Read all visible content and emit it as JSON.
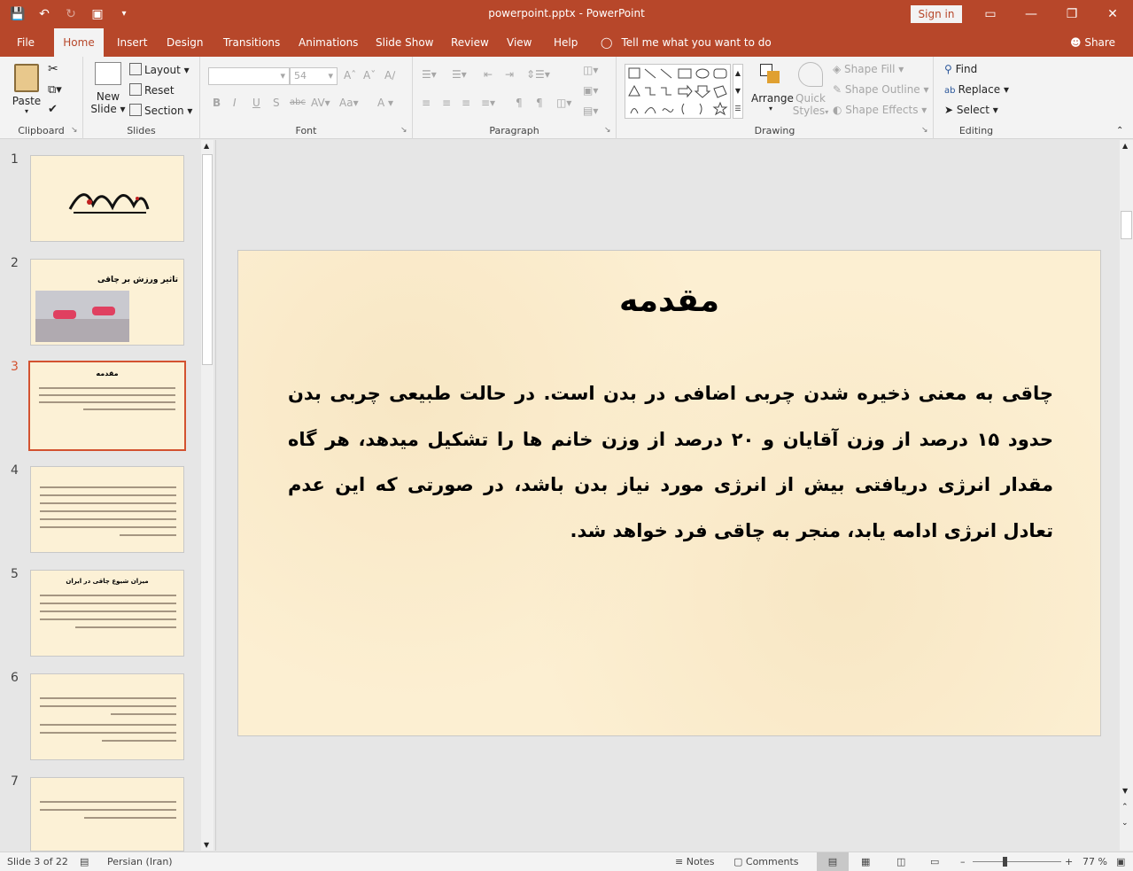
{
  "titlebar": {
    "doc_title": "powerpoint.pptx  -  PowerPoint",
    "sign_in": "Sign in"
  },
  "tabs": [
    "File",
    "Home",
    "Insert",
    "Design",
    "Transitions",
    "Animations",
    "Slide Show",
    "Review",
    "View",
    "Help"
  ],
  "active_tab": "Home",
  "tell_me": "Tell me what you want to do",
  "share": "Share",
  "ribbon": {
    "clipboard": {
      "label": "Clipboard",
      "paste": "Paste"
    },
    "slides": {
      "label": "Slides",
      "new_slide_1": "New",
      "new_slide_2": "Slide",
      "layout": "Layout",
      "reset": "Reset",
      "section": "Section"
    },
    "font": {
      "label": "Font",
      "size": "54"
    },
    "paragraph": {
      "label": "Paragraph"
    },
    "drawing": {
      "label": "Drawing",
      "arrange": "Arrange",
      "quick_1": "Quick",
      "quick_2": "Styles",
      "shape_fill": "Shape Fill",
      "shape_outline": "Shape Outline",
      "shape_effects": "Shape Effects"
    },
    "editing": {
      "label": "Editing",
      "find": "Find",
      "replace": "Replace",
      "select": "Select"
    }
  },
  "thumbnails": [
    {
      "num": "1"
    },
    {
      "num": "2",
      "title": "تاثیر ورزش بر چاقی"
    },
    {
      "num": "3",
      "title": "مقدمه"
    },
    {
      "num": "4"
    },
    {
      "num": "5",
      "title": "میزان شیوع چاقی در ایران"
    },
    {
      "num": "6"
    },
    {
      "num": "7"
    }
  ],
  "slide": {
    "title": "مقدمه",
    "body": "چاقی به معنی ذخیره شدن چربی اضافی در بدن است. در حالت طبیعی چربی بدن حدود ۱۵ درصد از وزن آقایان و ۲۰ درصد از وزن خانم ها را تشکیل میدهد، هر گاه مقدار انرژی دریافتی بیش از انرژی مورد نیاز بدن باشد، در صورتی که این عدم تعادل انرژی ادامه یابد، منجر به چاقی فرد خواهد شد."
  },
  "status": {
    "slide_info": "Slide 3 of 22",
    "language": "Persian (Iran)",
    "notes": "Notes",
    "comments": "Comments",
    "zoom": "77 %"
  }
}
